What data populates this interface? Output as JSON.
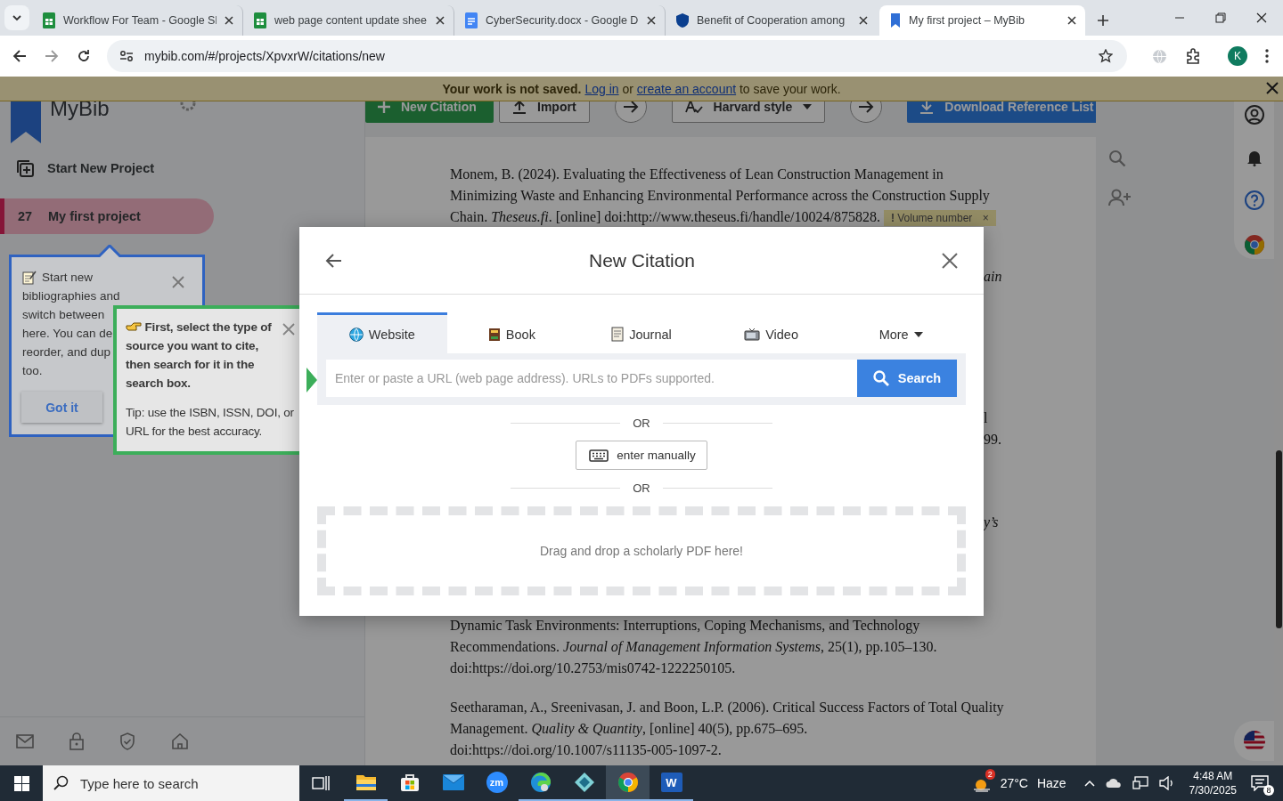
{
  "browser": {
    "tabs": [
      {
        "title": "Workflow For Team - Google Sl",
        "kind": "sheets",
        "selected": false
      },
      {
        "title": "web page content update shee",
        "kind": "sheets",
        "selected": false
      },
      {
        "title": "CyberSecurity.docx - Google D",
        "kind": "docs",
        "selected": false
      },
      {
        "title": "Benefit of Cooperation among",
        "kind": "shield",
        "selected": false
      },
      {
        "title": "My first project – MyBib",
        "kind": "bookmark",
        "selected": true
      }
    ],
    "address": "mybib.com/#/projects/XpvxrW/citations/new",
    "profile": "K"
  },
  "banner": {
    "bold": "Your work is not saved.",
    "link_1": "Log in",
    "middle": "or",
    "link_2": "create an account",
    "tail": "to save your work."
  },
  "toolbar": {
    "new_citation": "New Citation",
    "import": "Import",
    "style": "Harvard style",
    "download": "Download Reference List"
  },
  "sidebar": {
    "logo": "MyBib",
    "new_project": "Start New Project",
    "projects": [
      {
        "count": "27",
        "name": "My first project",
        "selected": true
      }
    ]
  },
  "sidebar_tip": {
    "lines": [
      "Start new",
      "bibliographies and",
      "switch between",
      "here. You can de",
      "reorder, and dup",
      "too."
    ],
    "button": "Got it"
  },
  "source_tip": {
    "text": "First, select the type of source you want to cite, then search for it in the search box.",
    "tip": "Tip: use the ISBN, ISSN, DOI, or URL for the best accuracy."
  },
  "document": {
    "entries_above": [
      {
        "text": "Monem, B. (2024). Evaluating the Effectiveness of Lean Construction Management in Minimizing Waste and Enhancing Environmental Performance across the Construction Supply Chain. *Theseus.fi*. [online] doi:http://www.theseus.fi/handle/10024/875828.",
        "badge": {
          "mark": "!",
          "label": "Volume number",
          "close": "×"
        }
      }
    ],
    "hidden_fragments": [
      {
        "text": "ain",
        "italic": true
      },
      {
        "text": "l",
        "italic": false
      },
      {
        "text": "99.",
        "italic": false
      },
      {
        "text": "y’s",
        "italic": true
      }
    ],
    "entries_below": [
      {
        "text": "Dynamic Task Environments: Interruptions, Coping Mechanisms, and Technology Recommendations. *Journal of Management Information Systems*, 25(1), pp.105–130. doi:https://doi.org/10.2753/mis0742-1222250105."
      },
      {
        "text": "Seetharaman, A., Sreenivasan, J. and Boon, L.P. (2006). Critical Success Factors of Total Quality Management. *Quality & Quantity*, [online] 40(5), pp.675–695. doi:https://doi.org/10.1007/s11135-005-1097-2."
      }
    ]
  },
  "modal": {
    "title": "New Citation",
    "tabs": [
      {
        "label": "Website",
        "kind": "website",
        "selected": true
      },
      {
        "label": "Book",
        "kind": "book",
        "selected": false
      },
      {
        "label": "Journal",
        "kind": "journal",
        "selected": false
      },
      {
        "label": "Video",
        "kind": "video",
        "selected": false
      },
      {
        "label": "More",
        "kind": "more",
        "selected": false
      }
    ],
    "search": {
      "placeholder": "Enter or paste a URL (web page address). URLs to PDFs supported.",
      "button": "Search"
    },
    "or_1": "OR",
    "manual_button": "enter manually",
    "or_2": "OR",
    "dropzone": "Drag and drop a scholarly PDF here!"
  },
  "taskbar": {
    "search_placeholder": "Type here to search",
    "apps": [
      {
        "kind": "explorer",
        "running": true,
        "selected": false
      },
      {
        "kind": "store",
        "running": false,
        "selected": false
      },
      {
        "kind": "mail",
        "running": false,
        "selected": false
      },
      {
        "kind": "zoom",
        "label": "zm",
        "running": false,
        "selected": false
      },
      {
        "kind": "edge",
        "running": true,
        "selected": false
      },
      {
        "kind": "diamond",
        "running": true,
        "selected": false
      },
      {
        "kind": "chrome",
        "running": true,
        "selected": true
      },
      {
        "kind": "word",
        "label": "W",
        "running": true,
        "selected": false
      }
    ],
    "weather": {
      "badge": "2",
      "temp": "27°C",
      "condition": "Haze"
    },
    "time": "4:48 AM",
    "date": "7/30/2025",
    "notifications": "8"
  }
}
